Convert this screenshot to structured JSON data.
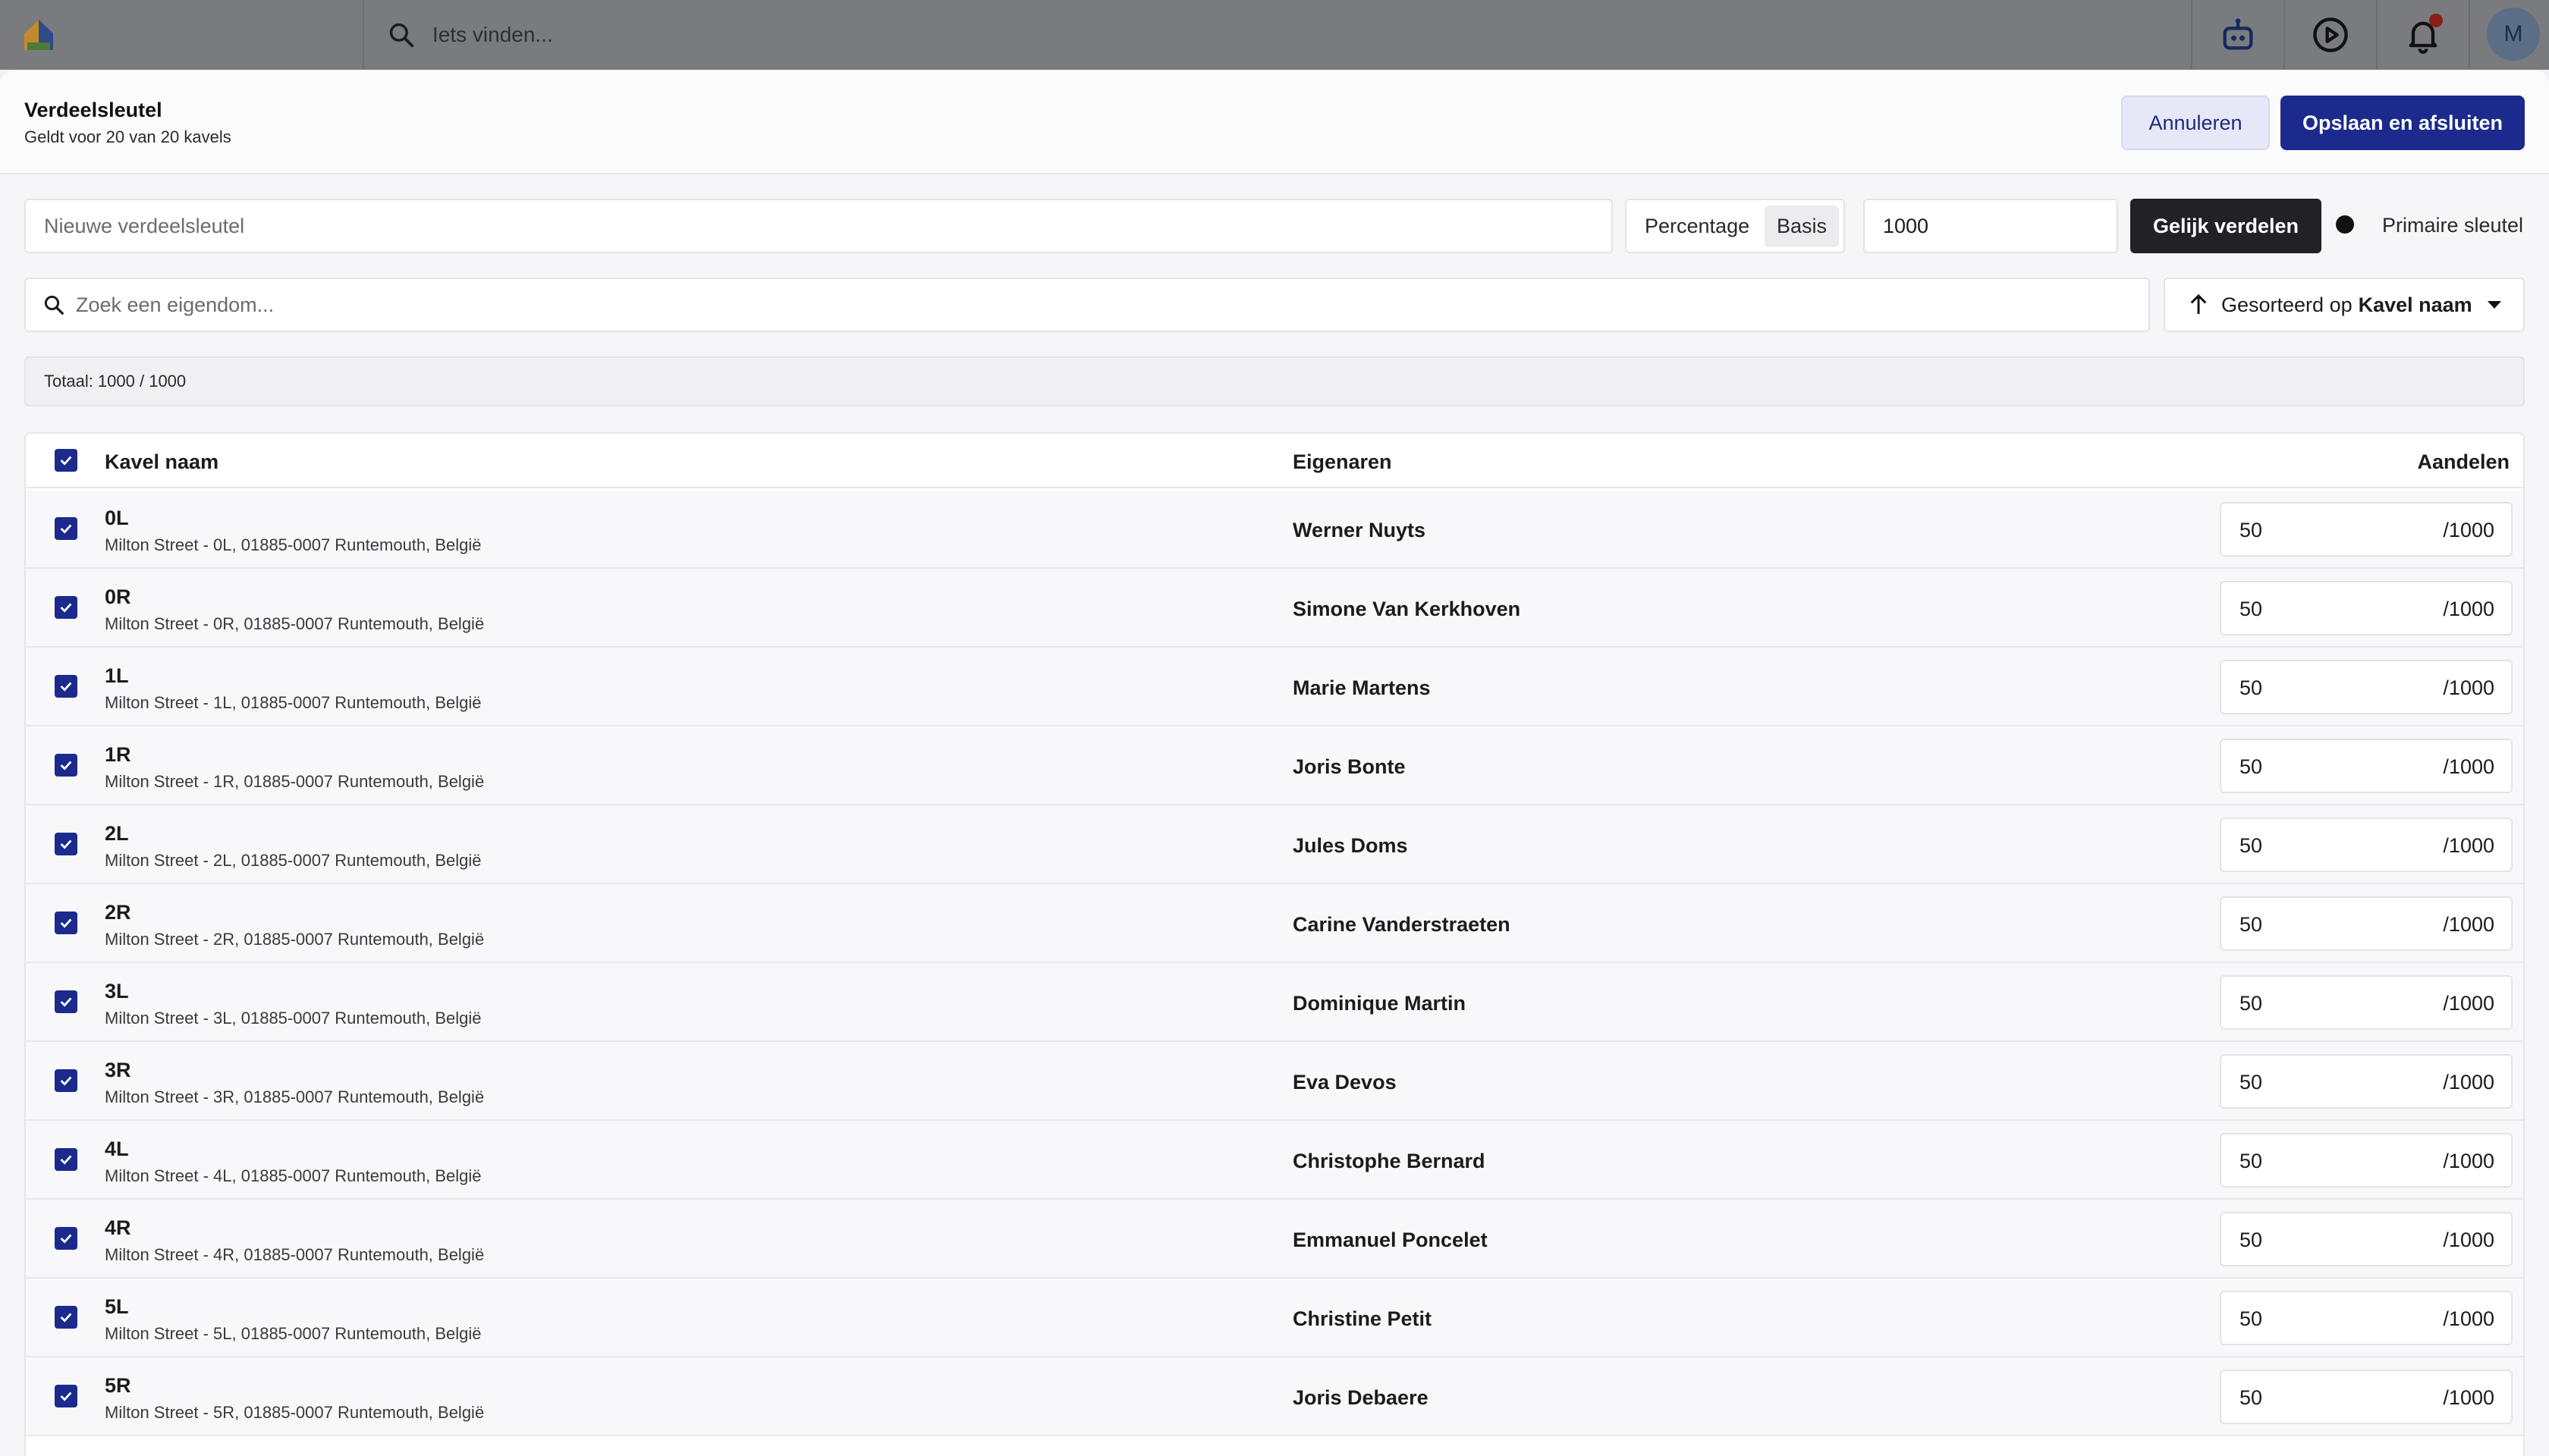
{
  "topbar": {
    "search_placeholder": "Iets vinden...",
    "avatar_initial": "M"
  },
  "modal": {
    "title": "Verdeelsleutel",
    "subtitle": "Geldt voor 20 van 20 kavels",
    "cancel_label": "Annuleren",
    "save_label": "Opslaan en afsluiten"
  },
  "key_form": {
    "name_placeholder": "Nieuwe verdeelsleutel",
    "mode_percentage": "Percentage",
    "mode_basis": "Basis",
    "basis_value": "1000",
    "equal_button": "Gelijk verdelen",
    "primary_label": "Primaire sleutel"
  },
  "filters": {
    "search_placeholder": "Zoek een eigendom...",
    "sort_prefix": "Gesorteerd op",
    "sort_field": "Kavel naam"
  },
  "total_text": "Totaal: 1000 / 1000",
  "table": {
    "headers": {
      "name": "Kavel naam",
      "owners": "Eigenaren",
      "shares": "Aandelen"
    },
    "rows": [
      {
        "name": "0L",
        "address": "Milton Street - 0L, 01885-0007 Runtemouth, België",
        "owner": "Werner Nuyts",
        "share": "50",
        "denom": "/1000"
      },
      {
        "name": "0R",
        "address": "Milton Street - 0R, 01885-0007 Runtemouth, België",
        "owner": "Simone Van Kerkhoven",
        "share": "50",
        "denom": "/1000"
      },
      {
        "name": "1L",
        "address": "Milton Street - 1L, 01885-0007 Runtemouth, België",
        "owner": "Marie Martens",
        "share": "50",
        "denom": "/1000"
      },
      {
        "name": "1R",
        "address": "Milton Street - 1R, 01885-0007 Runtemouth, België",
        "owner": "Joris Bonte",
        "share": "50",
        "denom": "/1000"
      },
      {
        "name": "2L",
        "address": "Milton Street - 2L, 01885-0007 Runtemouth, België",
        "owner": "Jules Doms",
        "share": "50",
        "denom": "/1000"
      },
      {
        "name": "2R",
        "address": "Milton Street - 2R, 01885-0007 Runtemouth, België",
        "owner": "Carine Vanderstraeten",
        "share": "50",
        "denom": "/1000"
      },
      {
        "name": "3L",
        "address": "Milton Street - 3L, 01885-0007 Runtemouth, België",
        "owner": "Dominique Martin",
        "share": "50",
        "denom": "/1000"
      },
      {
        "name": "3R",
        "address": "Milton Street - 3R, 01885-0007 Runtemouth, België",
        "owner": "Eva Devos",
        "share": "50",
        "denom": "/1000"
      },
      {
        "name": "4L",
        "address": "Milton Street - 4L, 01885-0007 Runtemouth, België",
        "owner": "Christophe Bernard",
        "share": "50",
        "denom": "/1000"
      },
      {
        "name": "4R",
        "address": "Milton Street - 4R, 01885-0007 Runtemouth, België",
        "owner": "Emmanuel Poncelet",
        "share": "50",
        "denom": "/1000"
      },
      {
        "name": "5L",
        "address": "Milton Street - 5L, 01885-0007 Runtemouth, België",
        "owner": "Christine Petit",
        "share": "50",
        "denom": "/1000"
      },
      {
        "name": "5R",
        "address": "Milton Street - 5R, 01885-0007 Runtemouth, België",
        "owner": "Joris Debaere",
        "share": "50",
        "denom": "/1000"
      }
    ]
  },
  "colors": {
    "primary": "#1b2a8c",
    "dark_button": "#222226",
    "topbar_dim": "#7a7b7f"
  },
  "icons": {
    "logo": "house-logo-icon",
    "search": "search-icon",
    "assistant": "robot-assistant-icon",
    "play": "play-circle-icon",
    "notifications": "bell-icon",
    "sort": "arrow-up-icon",
    "dropdown": "caret-down-icon",
    "checkbox": "checkmark-icon"
  }
}
